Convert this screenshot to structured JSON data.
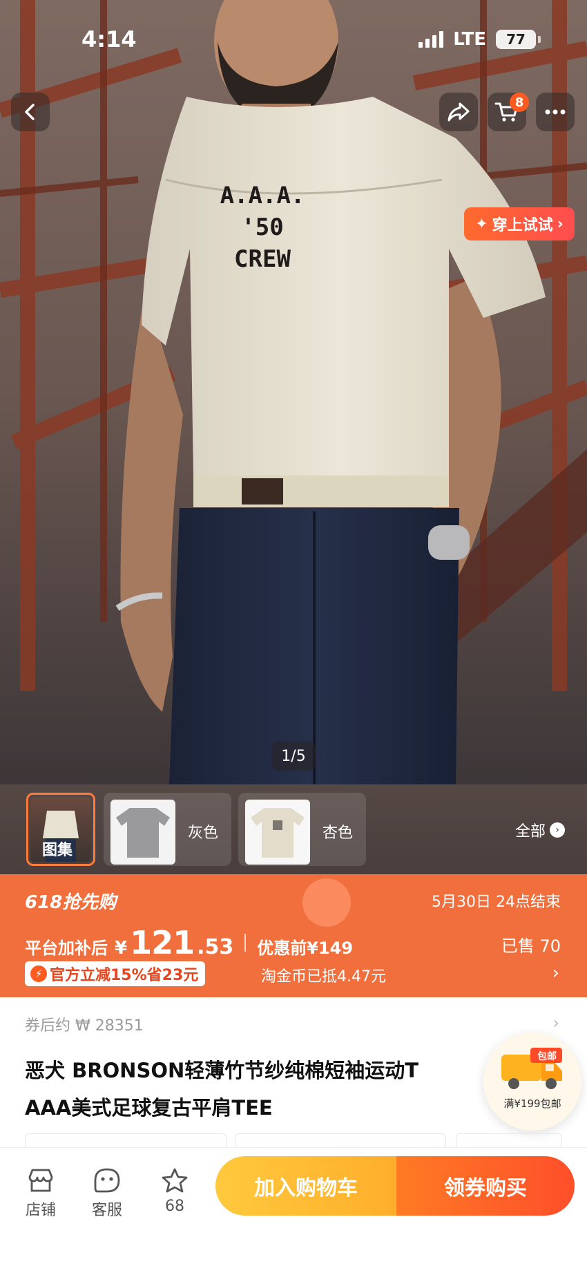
{
  "status": {
    "time": "4:14",
    "network": "LTE",
    "battery": "77"
  },
  "nav": {
    "cart_count": "8"
  },
  "tryon": {
    "label": "穿上试试"
  },
  "gallery": {
    "page": "1/5"
  },
  "thumbs": [
    {
      "label": "图集"
    },
    {
      "label": "灰色"
    },
    {
      "label": "杏色"
    }
  ],
  "thumbs_all": "全部",
  "promo": {
    "title": "618抢先购",
    "end": "5月30日 24点结束",
    "price_label": "平台加补后",
    "currency": "¥",
    "price_int": "121",
    "price_dec": ".53",
    "orig": "优惠前¥149",
    "sold": "已售 70",
    "badge": "官方立减15%省23元",
    "coin": "淘金币已抵4.47元"
  },
  "coupon": "券后约 ₩ 28351",
  "title_line1": "恶犬 BRONSON轻薄竹节纱纯棉短袖运动T",
  "title_line2": "AAA美式足球复古平肩TEE",
  "shipping": {
    "label": "满¥199包邮",
    "tag": "包邮"
  },
  "tshirt_print": [
    "A.A.A.",
    "'50",
    "CREW"
  ],
  "bottom": {
    "store": "店铺",
    "service": "客服",
    "fav": "68",
    "add_cart": "加入购物车",
    "buy": "领券购买"
  }
}
